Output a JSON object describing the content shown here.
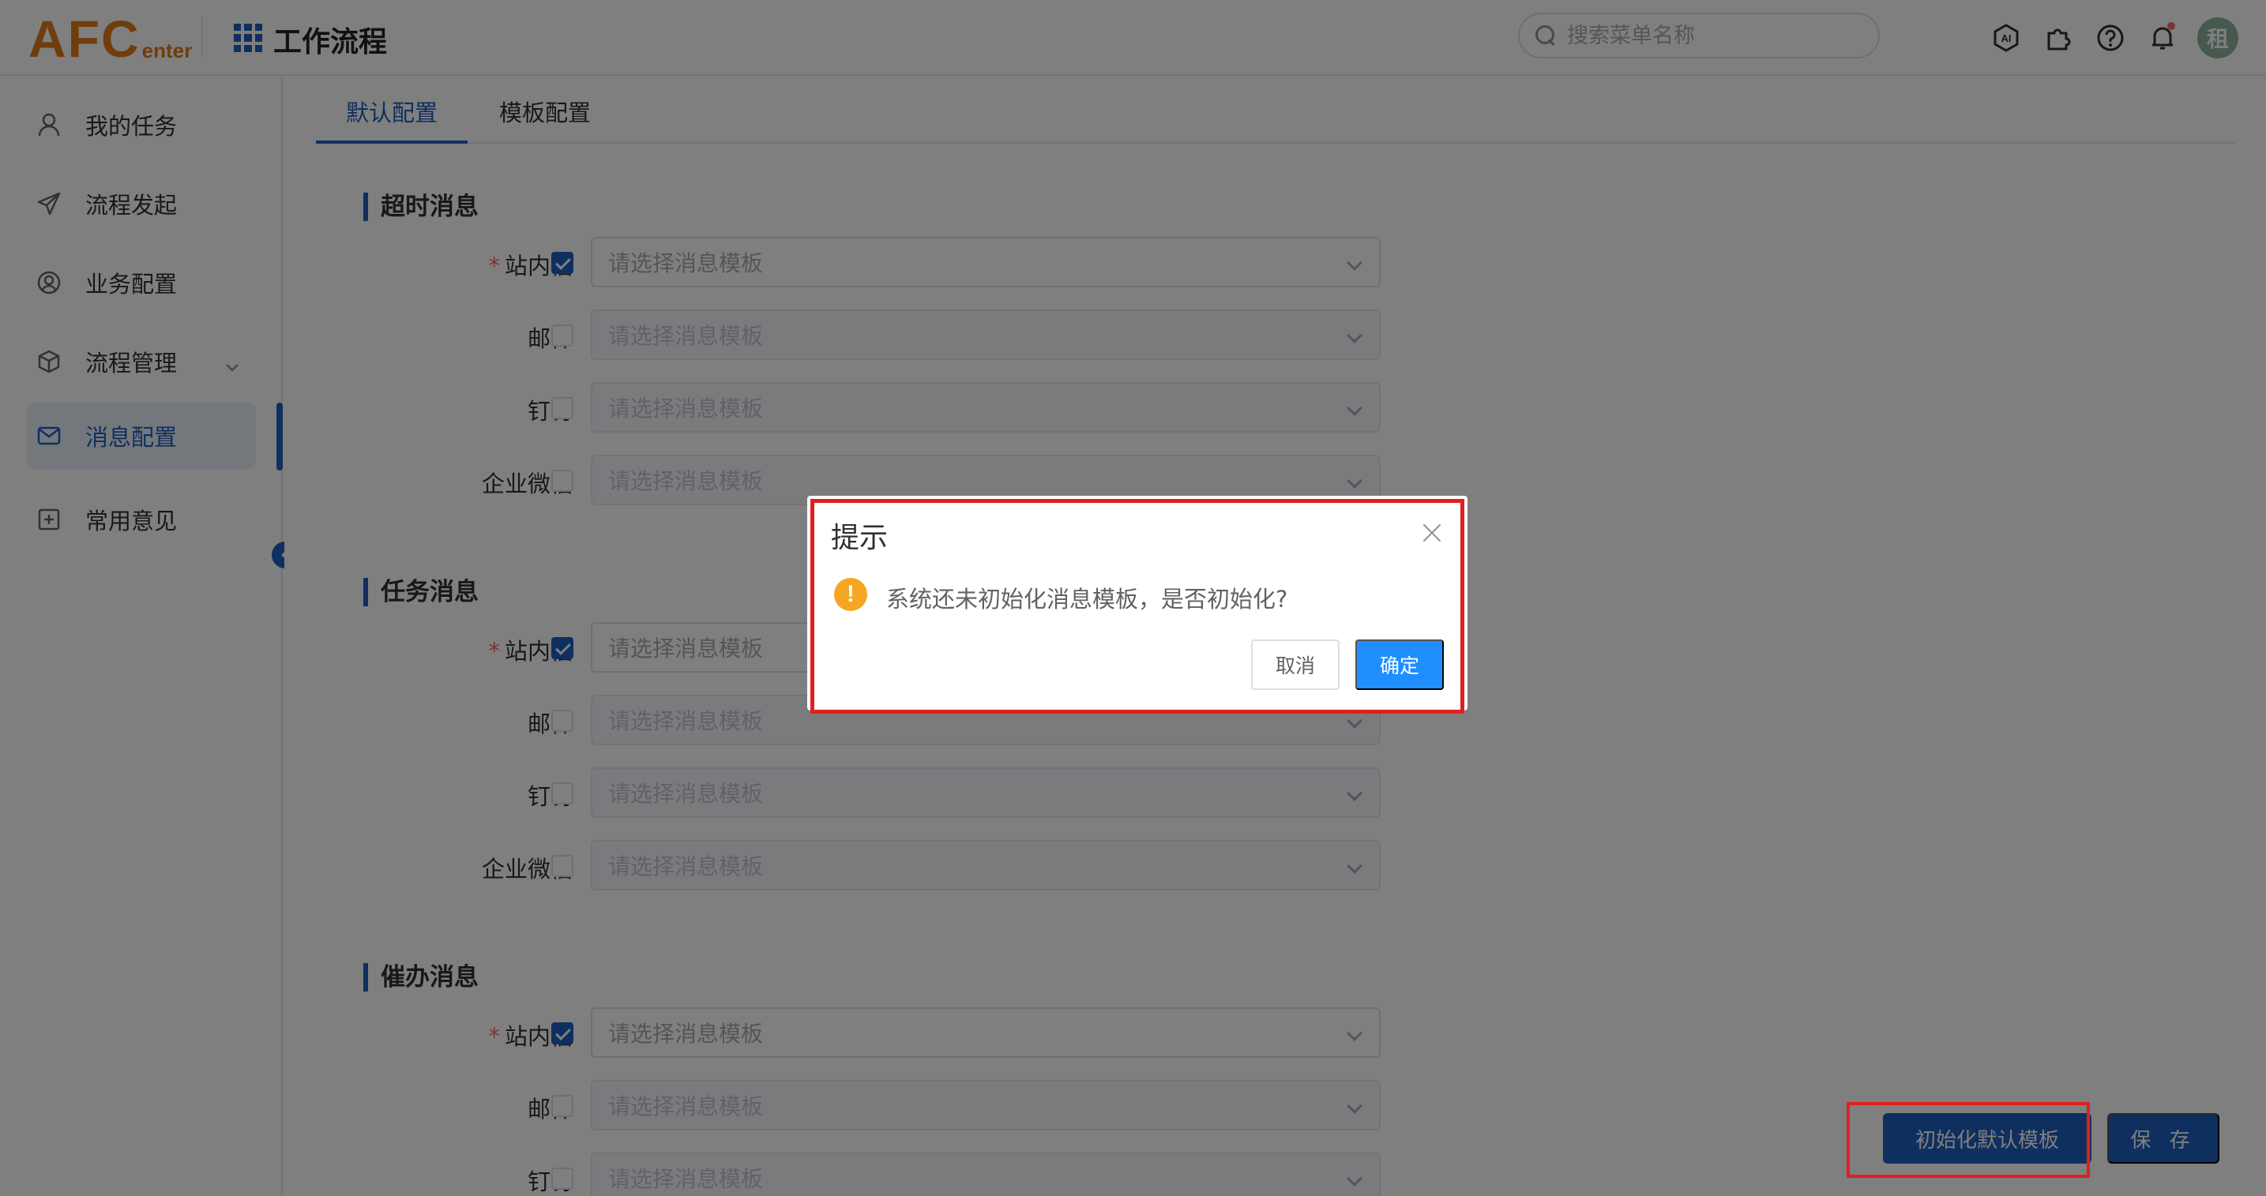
{
  "header": {
    "logo_main": "AFC",
    "logo_sub": "enter",
    "app_title": "工作流程",
    "search_placeholder": "搜索菜单名称",
    "avatar_text": "租",
    "icons": [
      "ai-icon",
      "plugin-icon",
      "help-icon",
      "bell-icon"
    ]
  },
  "sidebar": {
    "items": [
      {
        "label": "我的任务",
        "icon": "user-icon"
      },
      {
        "label": "流程发起",
        "icon": "send-icon"
      },
      {
        "label": "业务配置",
        "icon": "profile-circle-icon"
      },
      {
        "label": "流程管理",
        "icon": "cube-icon"
      },
      {
        "label": "消息配置",
        "icon": "mail-icon",
        "active": true
      },
      {
        "label": "常用意见",
        "icon": "plus-square-icon"
      }
    ]
  },
  "tabs": [
    {
      "label": "默认配置",
      "active": true
    },
    {
      "label": "模板配置",
      "active": false
    }
  ],
  "sections": [
    {
      "title": "超时消息",
      "rows": [
        {
          "label": "站内信",
          "required": true,
          "checked": true,
          "placeholder": "请选择消息模板"
        },
        {
          "label": "邮件",
          "required": false,
          "checked": false,
          "placeholder": "请选择消息模板"
        },
        {
          "label": "钉钉",
          "required": false,
          "checked": false,
          "placeholder": "请选择消息模板"
        },
        {
          "label": "企业微信",
          "required": false,
          "checked": false,
          "placeholder": "请选择消息模板"
        }
      ]
    },
    {
      "title": "任务消息",
      "rows": [
        {
          "label": "站内信",
          "required": true,
          "checked": true,
          "placeholder": "请选择消息模板"
        },
        {
          "label": "邮件",
          "required": false,
          "checked": false,
          "placeholder": "请选择消息模板"
        },
        {
          "label": "钉钉",
          "required": false,
          "checked": false,
          "placeholder": "请选择消息模板"
        },
        {
          "label": "企业微信",
          "required": false,
          "checked": false,
          "placeholder": "请选择消息模板"
        }
      ]
    },
    {
      "title": "催办消息",
      "rows": [
        {
          "label": "站内信",
          "required": true,
          "checked": true,
          "placeholder": "请选择消息模板"
        },
        {
          "label": "邮件",
          "required": false,
          "checked": false,
          "placeholder": "请选择消息模板"
        },
        {
          "label": "钉钉",
          "required": false,
          "checked": false,
          "placeholder": "请选择消息模板"
        }
      ]
    }
  ],
  "actions": {
    "init_label": "初始化默认模板",
    "save_label": "保 存"
  },
  "dialog": {
    "title": "提示",
    "icon": "warning-icon",
    "icon_glyph": "!",
    "message": "系统还未初始化消息模板，是否初始化?",
    "cancel_label": "取消",
    "ok_label": "确定"
  },
  "colors": {
    "primary": "#1f5fbf",
    "logo": "#e07b1a",
    "highlight": "#e02020",
    "warning": "#f5a623",
    "ok_button": "#1f8fff"
  }
}
